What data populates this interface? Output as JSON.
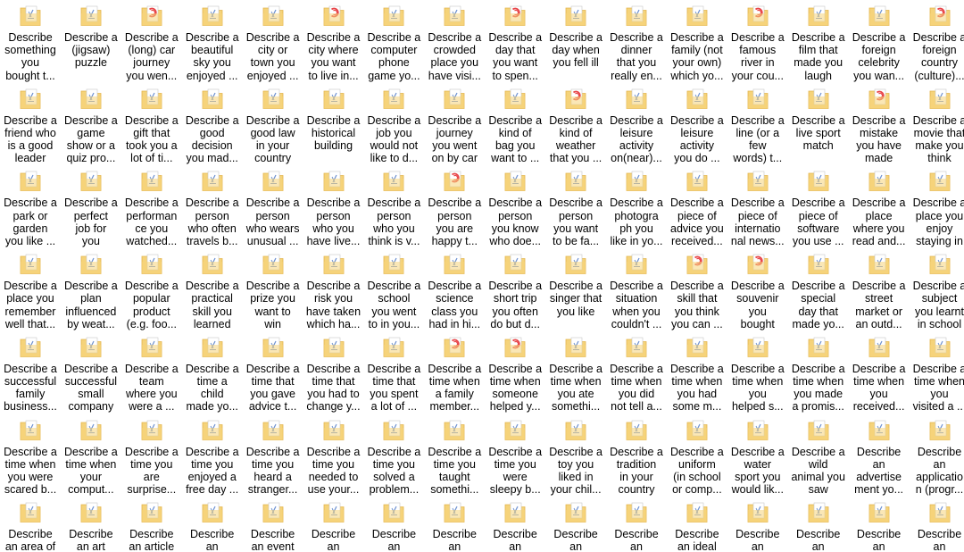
{
  "explorer": {
    "colors": {
      "folder_body": "#f5d37a",
      "folder_edge": "#e4b54d",
      "page": "#ffffff",
      "page_blue": "#6a8fd0",
      "page_red": "#e8464a"
    },
    "items": [
      {
        "name": "Describe\nsomething\nyou\nbought t...",
        "icon": "word-doc-folder-icon"
      },
      {
        "name": "Describe a\n(jigsaw)\npuzzle",
        "icon": "word-doc-folder-icon"
      },
      {
        "name": "Describe a\n(long) car\njourney\nyou wen...",
        "icon": "pdf-doc-folder-icon"
      },
      {
        "name": "Describe a\nbeautiful\nsky you\nenjoyed ...",
        "icon": "word-doc-folder-icon"
      },
      {
        "name": "Describe a\ncity or\ntown you\nenjoyed ...",
        "icon": "word-doc-folder-icon"
      },
      {
        "name": "Describe a\ncity where\nyou want\nto live in...",
        "icon": "pdf-doc-folder-icon"
      },
      {
        "name": "Describe a\ncomputer\nphone\ngame yo...",
        "icon": "word-doc-folder-icon"
      },
      {
        "name": "Describe a\ncrowded\nplace you\nhave visi...",
        "icon": "word-doc-folder-icon"
      },
      {
        "name": "Describe a\nday that\nyou want\nto spen...",
        "icon": "pdf-doc-folder-icon"
      },
      {
        "name": "Describe a\nday when\nyou fell ill",
        "icon": "word-doc-folder-icon"
      },
      {
        "name": "Describe a\ndinner\nthat you\nreally en...",
        "icon": "word-doc-folder-icon"
      },
      {
        "name": "Describe a\nfamily (not\nyour own)\nwhich yo...",
        "icon": "word-doc-folder-icon"
      },
      {
        "name": "Describe a\nfamous\nriver in\nyour cou...",
        "icon": "pdf-doc-folder-icon"
      },
      {
        "name": "Describe a\nfilm that\nmade you\nlaugh",
        "icon": "word-doc-folder-icon"
      },
      {
        "name": "Describe a\nforeign\ncelebrity\nyou wan...",
        "icon": "word-doc-folder-icon"
      },
      {
        "name": "Describe a\nforeign\ncountry\n(culture)...",
        "icon": "pdf-doc-folder-icon"
      },
      {
        "name": "Describe a\nfriend who\nis a good\nleader",
        "icon": "word-doc-folder-icon"
      },
      {
        "name": "Describe a\ngame\nshow or a\nquiz pro...",
        "icon": "word-doc-folder-icon"
      },
      {
        "name": "Describe a\ngift that\ntook you a\nlot of ti...",
        "icon": "word-doc-folder-icon"
      },
      {
        "name": "Describe a\ngood\ndecision\nyou mad...",
        "icon": "word-doc-folder-icon"
      },
      {
        "name": "Describe a\ngood law\nin your\ncountry",
        "icon": "word-doc-folder-icon"
      },
      {
        "name": "Describe a\nhistorical\nbuilding",
        "icon": "word-doc-folder-icon"
      },
      {
        "name": "Describe a\njob you\nwould not\nlike to d...",
        "icon": "word-doc-folder-icon"
      },
      {
        "name": "Describe a\njourney\nyou went\non by car",
        "icon": "word-doc-folder-icon"
      },
      {
        "name": "Describe a\nkind of\nbag you\nwant to ...",
        "icon": "word-doc-folder-icon"
      },
      {
        "name": "Describe a\nkind of\nweather\nthat you ...",
        "icon": "pdf-doc-folder-icon"
      },
      {
        "name": "Describe a\nleisure\nactivity\non(near)...",
        "icon": "word-doc-folder-icon"
      },
      {
        "name": "Describe a\nleisure\nactivity\nyou do ...",
        "icon": "word-doc-folder-icon"
      },
      {
        "name": "Describe a\nline (or a\nfew\nwords) t...",
        "icon": "word-doc-folder-icon"
      },
      {
        "name": "Describe a\nlive sport\nmatch",
        "icon": "word-doc-folder-icon"
      },
      {
        "name": "Describe a\nmistake\nyou have\nmade",
        "icon": "pdf-doc-folder-icon"
      },
      {
        "name": "Describe a\nmovie that\nmake you\nthink",
        "icon": "word-doc-folder-icon"
      },
      {
        "name": "Describe a\npark or\ngarden\nyou like ...",
        "icon": "word-doc-folder-icon"
      },
      {
        "name": "Describe a\nperfect\njob for\nyou",
        "icon": "word-doc-folder-icon"
      },
      {
        "name": "Describe a\nperforman\nce you\nwatched...",
        "icon": "word-doc-folder-icon"
      },
      {
        "name": "Describe a\nperson\nwho often\ntravels b...",
        "icon": "word-doc-folder-icon"
      },
      {
        "name": "Describe a\nperson\nwho wears\nunusual ...",
        "icon": "word-doc-folder-icon"
      },
      {
        "name": "Describe a\nperson\nwho you\nhave live...",
        "icon": "word-doc-folder-icon"
      },
      {
        "name": "Describe a\nperson\nwho you\nthink is v...",
        "icon": "word-doc-folder-icon"
      },
      {
        "name": "Describe a\nperson\nyou are\nhappy t...",
        "icon": "pdf-doc-folder-icon"
      },
      {
        "name": "Describe a\nperson\nyou know\nwho doe...",
        "icon": "word-doc-folder-icon"
      },
      {
        "name": "Describe a\nperson\nyou want\nto be fa...",
        "icon": "word-doc-folder-icon"
      },
      {
        "name": "Describe a\nphotogra\nph you\nlike in yo...",
        "icon": "word-doc-folder-icon"
      },
      {
        "name": "Describe a\npiece of\nadvice you\nreceived...",
        "icon": "word-doc-folder-icon"
      },
      {
        "name": "Describe a\npiece of\ninternatio\nnal news...",
        "icon": "word-doc-folder-icon"
      },
      {
        "name": "Describe a\npiece of\nsoftware\nyou use ...",
        "icon": "word-doc-folder-icon"
      },
      {
        "name": "Describe a\nplace\nwhere you\nread and...",
        "icon": "word-doc-folder-icon"
      },
      {
        "name": "Describe a\nplace you\nenjoy\nstaying in",
        "icon": "word-doc-folder-icon"
      },
      {
        "name": "Describe a\nplace you\nremember\nwell that...",
        "icon": "word-doc-folder-icon"
      },
      {
        "name": "Describe a\nplan\ninfluenced\nby weat...",
        "icon": "word-doc-folder-icon"
      },
      {
        "name": "Describe a\npopular\nproduct\n(e.g. foo...",
        "icon": "word-doc-folder-icon"
      },
      {
        "name": "Describe a\npractical\nskill you\nlearned",
        "icon": "word-doc-folder-icon"
      },
      {
        "name": "Describe a\nprize you\nwant to\nwin",
        "icon": "word-doc-folder-icon"
      },
      {
        "name": "Describe a\nrisk you\nhave taken\nwhich ha...",
        "icon": "word-doc-folder-icon"
      },
      {
        "name": "Describe a\nschool\nyou went\nto in you...",
        "icon": "word-doc-folder-icon"
      },
      {
        "name": "Describe a\nscience\nclass you\nhad in hi...",
        "icon": "word-doc-folder-icon"
      },
      {
        "name": "Describe a\nshort trip\nyou often\ndo but d...",
        "icon": "word-doc-folder-icon"
      },
      {
        "name": "Describe a\nsinger that\nyou like",
        "icon": "word-doc-folder-icon"
      },
      {
        "name": "Describe a\nsituation\nwhen you\ncouldn't ...",
        "icon": "word-doc-folder-icon"
      },
      {
        "name": "Describe a\nskill that\nyou think\nyou can ...",
        "icon": "pdf-doc-folder-icon"
      },
      {
        "name": "Describe a\nsouvenir\nyou\nbought",
        "icon": "pdf-doc-folder-icon"
      },
      {
        "name": "Describe a\nspecial\nday that\nmade yo...",
        "icon": "word-doc-folder-icon"
      },
      {
        "name": "Describe a\nstreet\nmarket or\nan outd...",
        "icon": "word-doc-folder-icon"
      },
      {
        "name": "Describe a\nsubject\nyou learnt\nin school",
        "icon": "word-doc-folder-icon"
      },
      {
        "name": "Describe a\nsuccessful\nfamily\nbusiness...",
        "icon": "word-doc-folder-icon"
      },
      {
        "name": "Describe a\nsuccessful\nsmall\ncompany",
        "icon": "word-doc-folder-icon"
      },
      {
        "name": "Describe a\nteam\nwhere you\nwere a ...",
        "icon": "word-doc-folder-icon"
      },
      {
        "name": "Describe a\ntime a\nchild\nmade yo...",
        "icon": "word-doc-folder-icon"
      },
      {
        "name": "Describe a\ntime that\nyou gave\nadvice t...",
        "icon": "word-doc-folder-icon"
      },
      {
        "name": "Describe a\ntime that\nyou had to\nchange y...",
        "icon": "word-doc-folder-icon"
      },
      {
        "name": "Describe a\ntime that\nyou spent\na lot of ...",
        "icon": "word-doc-folder-icon"
      },
      {
        "name": "Describe a\ntime when\na family\nmember...",
        "icon": "pdf-doc-folder-icon"
      },
      {
        "name": "Describe a\ntime when\nsomeone\nhelped y...",
        "icon": "pdf-doc-folder-icon"
      },
      {
        "name": "Describe a\ntime when\nyou ate\nsomethi...",
        "icon": "word-doc-folder-icon"
      },
      {
        "name": "Describe a\ntime when\nyou did\nnot tell a...",
        "icon": "word-doc-folder-icon"
      },
      {
        "name": "Describe a\ntime when\nyou had\nsome m...",
        "icon": "word-doc-folder-icon"
      },
      {
        "name": "Describe a\ntime when\nyou\nhelped s...",
        "icon": "word-doc-folder-icon"
      },
      {
        "name": "Describe a\ntime when\nyou made\na promis...",
        "icon": "word-doc-folder-icon"
      },
      {
        "name": "Describe a\ntime when\nyou\nreceived...",
        "icon": "word-doc-folder-icon"
      },
      {
        "name": "Describe a\ntime when\nyou\nvisited a ...",
        "icon": "word-doc-folder-icon"
      },
      {
        "name": "Describe a\ntime when\nyou were\nscared b...",
        "icon": "word-doc-folder-icon"
      },
      {
        "name": "Describe a\ntime when\nyour\ncomput...",
        "icon": "word-doc-folder-icon"
      },
      {
        "name": "Describe a\ntime you\nare\nsurprise...",
        "icon": "word-doc-folder-icon"
      },
      {
        "name": "Describe a\ntime you\nenjoyed a\nfree day ...",
        "icon": "word-doc-folder-icon"
      },
      {
        "name": "Describe a\ntime you\nheard a\nstranger...",
        "icon": "word-doc-folder-icon"
      },
      {
        "name": "Describe a\ntime you\nneeded to\nuse your...",
        "icon": "word-doc-folder-icon"
      },
      {
        "name": "Describe a\ntime you\nsolved a\nproblem...",
        "icon": "word-doc-folder-icon"
      },
      {
        "name": "Describe a\ntime you\ntaught\nsomethi...",
        "icon": "word-doc-folder-icon"
      },
      {
        "name": "Describe a\ntime you\nwere\nsleepy b...",
        "icon": "word-doc-folder-icon"
      },
      {
        "name": "Describe a\ntoy you\nliked in\nyour chil...",
        "icon": "word-doc-folder-icon"
      },
      {
        "name": "Describe a\ntradition\nin your\ncountry",
        "icon": "word-doc-folder-icon"
      },
      {
        "name": "Describe a\nuniform\n(in school\nor comp...",
        "icon": "word-doc-folder-icon"
      },
      {
        "name": "Describe a\nwater\nsport you\nwould lik...",
        "icon": "word-doc-folder-icon"
      },
      {
        "name": "Describe a\nwild\nanimal you\nsaw",
        "icon": "word-doc-folder-icon"
      },
      {
        "name": "Describe\nan\nadvertise\nment yo...",
        "icon": "word-doc-folder-icon"
      },
      {
        "name": "Describe\nan\napplicatio\nn (progr...",
        "icon": "word-doc-folder-icon"
      },
      {
        "name": "Describe\nan area of",
        "icon": "word-doc-folder-icon"
      },
      {
        "name": "Describe\nan art",
        "icon": "word-doc-folder-icon"
      },
      {
        "name": "Describe\nan article",
        "icon": "word-doc-folder-icon"
      },
      {
        "name": "Describe\nan",
        "icon": "word-doc-folder-icon"
      },
      {
        "name": "Describe\nan event",
        "icon": "word-doc-folder-icon"
      },
      {
        "name": "Describe\nan",
        "icon": "word-doc-folder-icon"
      },
      {
        "name": "Describe\nan",
        "icon": "word-doc-folder-icon"
      },
      {
        "name": "Describe\nan",
        "icon": "word-doc-folder-icon"
      },
      {
        "name": "Describe\nan",
        "icon": "word-doc-folder-icon"
      },
      {
        "name": "Describe\nan",
        "icon": "word-doc-folder-icon"
      },
      {
        "name": "Describe\nan",
        "icon": "word-doc-folder-icon"
      },
      {
        "name": "Describe\nan ideal",
        "icon": "word-doc-folder-icon"
      },
      {
        "name": "Describe\nan",
        "icon": "word-doc-folder-icon"
      },
      {
        "name": "Describe\nan",
        "icon": "word-doc-folder-icon"
      },
      {
        "name": "Describe\nan",
        "icon": "word-doc-folder-icon"
      },
      {
        "name": "Describe\nan",
        "icon": "word-doc-folder-icon"
      }
    ]
  }
}
